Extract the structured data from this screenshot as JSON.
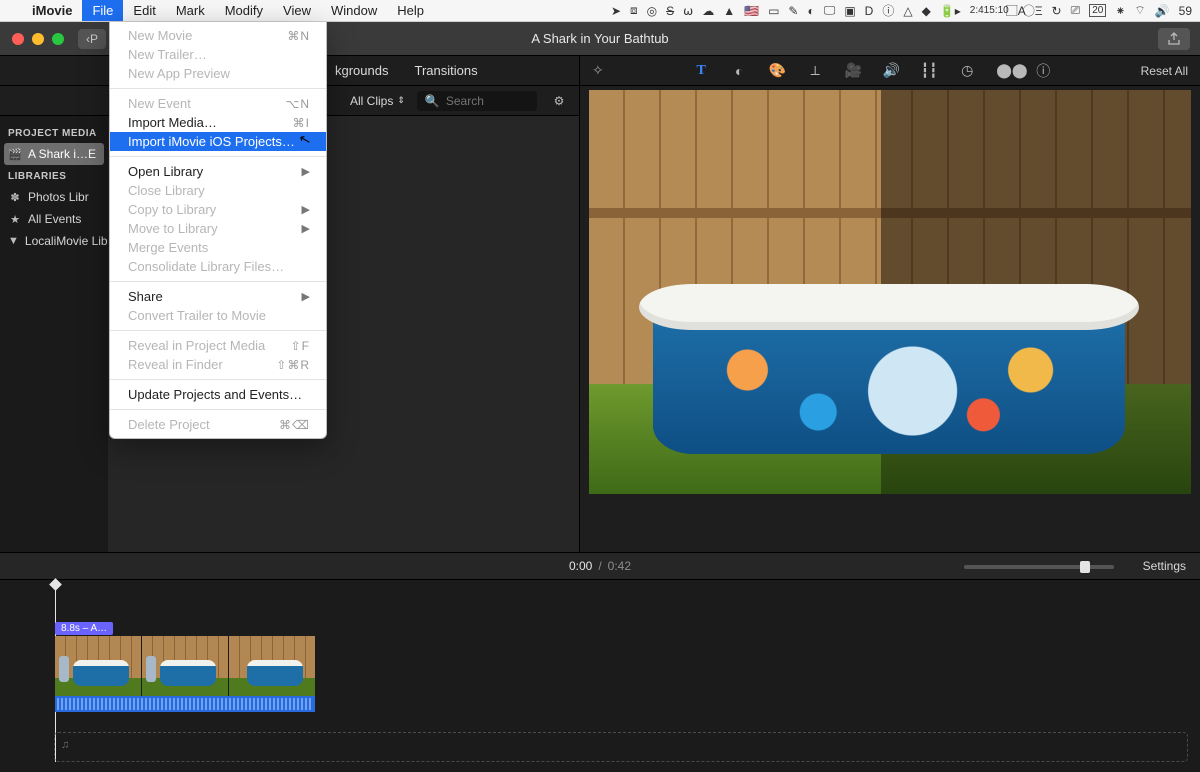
{
  "menubar": {
    "app_name": "iMovie",
    "items": [
      "File",
      "Edit",
      "Mark",
      "Modify",
      "View",
      "Window",
      "Help"
    ],
    "active_index": 0,
    "clock_time": "2:41",
    "clock_sub": "5:10",
    "tray_date": "20",
    "tray_pct": "59"
  },
  "dropdown": {
    "groups": [
      [
        {
          "label": "New Movie",
          "shortcut": "⌘N",
          "disabled": true
        },
        {
          "label": "New Trailer…",
          "shortcut": "",
          "disabled": true
        },
        {
          "label": "New App Preview",
          "shortcut": "",
          "disabled": true
        }
      ],
      [
        {
          "label": "New Event",
          "shortcut": "⌥N",
          "disabled": true
        },
        {
          "label": "Import Media…",
          "shortcut": "⌘I",
          "disabled": false
        },
        {
          "label": "Import iMovie iOS Projects…",
          "shortcut": "",
          "disabled": false,
          "highlight": true
        }
      ],
      [
        {
          "label": "Open Library",
          "shortcut": "▶",
          "disabled": false
        },
        {
          "label": "Close Library",
          "shortcut": "",
          "disabled": true
        },
        {
          "label": "Copy to Library",
          "shortcut": "▶",
          "disabled": true
        },
        {
          "label": "Move to Library",
          "shortcut": "▶",
          "disabled": true
        },
        {
          "label": "Merge Events",
          "shortcut": "",
          "disabled": true
        },
        {
          "label": "Consolidate Library Files…",
          "shortcut": "",
          "disabled": true
        }
      ],
      [
        {
          "label": "Share",
          "shortcut": "▶",
          "disabled": false
        },
        {
          "label": "Convert Trailer to Movie",
          "shortcut": "",
          "disabled": true
        }
      ],
      [
        {
          "label": "Reveal in Project Media",
          "shortcut": "⇧F",
          "disabled": true
        },
        {
          "label": "Reveal in Finder",
          "shortcut": "⇧⌘R",
          "disabled": true
        }
      ],
      [
        {
          "label": "Update Projects and Events…",
          "shortcut": "",
          "disabled": false
        }
      ],
      [
        {
          "label": "Delete Project",
          "shortcut": "⌘⌫",
          "disabled": true
        }
      ]
    ]
  },
  "window": {
    "title": "A Shark in Your Bathtub",
    "back_label": "P"
  },
  "tabs": {
    "backgrounds": "kgrounds",
    "transitions": "Transitions"
  },
  "filter": {
    "allclips": "All Clips",
    "search_placeholder": "Search"
  },
  "sidebar": {
    "section1": "PROJECT MEDIA",
    "project_item": "A Shark i…E",
    "section2": "LIBRARIES",
    "lib_photos": "Photos Libr",
    "lib_events": "All Events",
    "lib_local": "LocaliMovie Lib"
  },
  "viewer": {
    "reset": "Reset All"
  },
  "playback": {
    "current": "0:00",
    "total": "0:42",
    "settings": "Settings"
  },
  "timeline": {
    "clip_label": "8.8s – A…",
    "music_icon": "♫"
  }
}
